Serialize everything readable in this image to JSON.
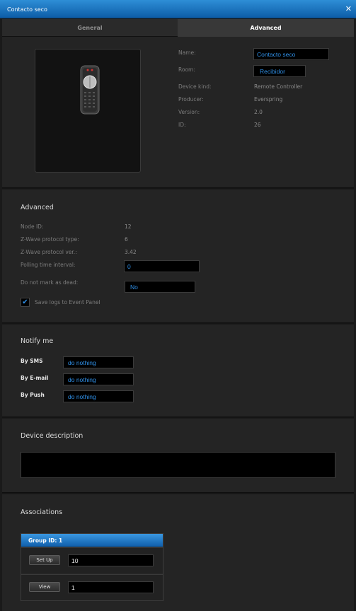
{
  "window": {
    "title": "Contacto seco",
    "close_glyph": "✕"
  },
  "tabs": [
    {
      "label": "General",
      "active": false
    },
    {
      "label": "Advanced",
      "active": true
    }
  ],
  "device": {
    "image_icon": "remote-controller-icon",
    "name_label": "Name:",
    "name_value": "Contacto seco",
    "room_label": "Room:",
    "room_value": "Recibidor",
    "kind_label": "Device kind:",
    "kind_value": "Remote Controller",
    "producer_label": "Producer:",
    "producer_value": "Everspring",
    "version_label": "Version:",
    "version_value": "2.0",
    "id_label": "ID:",
    "id_value": "26"
  },
  "advanced": {
    "heading": "Advanced",
    "node_id_label": "Node ID:",
    "node_id_value": "12",
    "zwave_type_label": "Z-Wave protocol type:",
    "zwave_type_value": "6",
    "zwave_ver_label": "Z-Wave protocol ver.:",
    "zwave_ver_value": "3.42",
    "polling_label": "Polling time interval:",
    "polling_value": "0",
    "dead_label": "Do not mark as dead:",
    "dead_value": "No",
    "save_logs_label": "Save logs to Event Panel",
    "save_logs_checked": true
  },
  "notify": {
    "heading": "Notify me",
    "sms_label": "By SMS",
    "sms_value": "do nothing",
    "email_label": "By E-mail",
    "email_value": "do nothing",
    "push_label": "By Push",
    "push_value": "do nothing"
  },
  "description": {
    "heading": "Device description",
    "value": ""
  },
  "associations": {
    "heading": "Associations",
    "group_title": "Group ID: 1",
    "setup_label": "Set Up",
    "setup_value": "10",
    "view_label": "View",
    "view_value": "1"
  },
  "colors": {
    "accent": "#2f8fe6",
    "titlebar": "#1672c2",
    "panel": "#242424"
  }
}
